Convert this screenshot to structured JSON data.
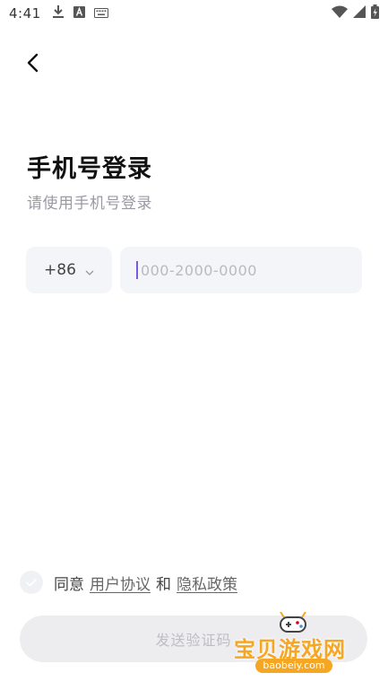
{
  "status_bar": {
    "time": "4:41"
  },
  "icons": {
    "back": "back-arrow-icon",
    "download": "download-icon",
    "font": "font-icon",
    "keyboard": "keyboard-icon",
    "wifi": "wifi-icon",
    "signal": "signal-icon",
    "battery": "battery-icon",
    "chevron": "chevron-down-icon"
  },
  "header": {
    "title": "手机号登录",
    "subtitle": "请使用手机号登录"
  },
  "phone": {
    "country_code": "+86",
    "placeholder": "000-2000-0000",
    "value": ""
  },
  "agreement": {
    "prefix": "同意",
    "user_agreement": "用户协议",
    "and": "和",
    "privacy_policy": "隐私政策",
    "checked": false
  },
  "actions": {
    "send_code": "发送验证码"
  },
  "watermark": {
    "text": "宝贝游戏网",
    "url": "baobeiy.com"
  },
  "colors": {
    "accent": "#7b5bd6",
    "input_bg": "#f4f5f8",
    "button_disabled_bg": "#ededf0",
    "watermark": "#f5a623"
  }
}
